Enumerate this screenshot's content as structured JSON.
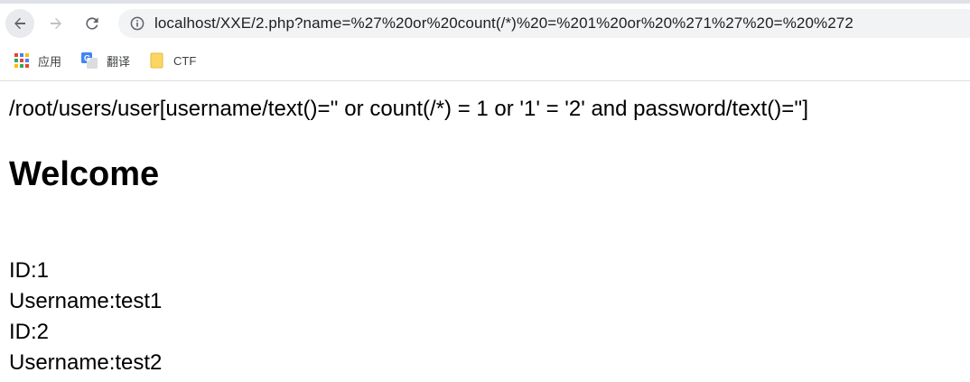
{
  "browser": {
    "url": "localhost/XXE/2.php?name=%27%20or%20count(/*)%20=%201%20or%20%271%27%20=%20%272",
    "bookmarks": [
      {
        "label": "应用",
        "icon": "apps-grid-icon"
      },
      {
        "label": "翻译",
        "icon": "translate-icon"
      },
      {
        "label": "CTF",
        "icon": "folder-icon"
      }
    ]
  },
  "page": {
    "query": "/root/users/user[username/text()='' or count(/*) = 1 or '1' = '2' and password/text()='']",
    "heading": "Welcome",
    "results": [
      "ID:1",
      "Username:test1",
      "ID:2",
      "Username:test2"
    ]
  }
}
